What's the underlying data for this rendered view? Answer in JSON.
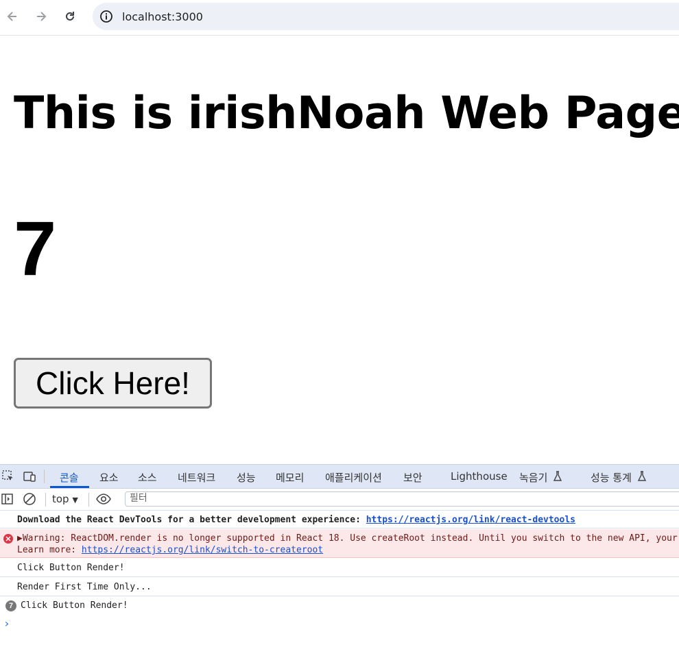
{
  "browser": {
    "url": "localhost:3000",
    "icons": [
      "back-arrow-icon",
      "forward-arrow-icon",
      "reload-icon",
      "site-info-icon"
    ]
  },
  "page": {
    "title": "This is irishNoah Web Page!",
    "counter": "7",
    "button_label": "Click Here!"
  },
  "devtools": {
    "tabs": [
      {
        "label": "콘솔",
        "active": true
      },
      {
        "label": "요소"
      },
      {
        "label": "소스"
      },
      {
        "label": "네트워크"
      },
      {
        "label": "성능"
      },
      {
        "label": "메모리"
      },
      {
        "label": "애플리케이션"
      },
      {
        "label": "보안"
      },
      {
        "label": "Lighthouse"
      },
      {
        "label": "녹음기"
      },
      {
        "label": "성능 통계"
      }
    ],
    "context": "top",
    "filter_placeholder": "필터",
    "messages": {
      "m1_text": "Download the React DevTools for a better development experience: ",
      "m1_link": "https://reactjs.org/link/react-devtools",
      "m2_line1": "▶Warning: ReactDOM.render is no longer supported in React 18. Use createRoot instead. Until you switch to the new API, your app will b",
      "m2_line2": "Learn more: ",
      "m2_link": "https://reactjs.org/link/switch-to-createroot",
      "m3": "Click Button Render!",
      "m4": "Render First Time Only...",
      "m5_count": "7",
      "m5": "Click Button Render!"
    },
    "prompt": "›",
    "colors": {
      "accent": "#0b57d0",
      "error_bg": "#fce8e8",
      "error_icon": "#dc3545",
      "link": "#1a4fcf"
    }
  }
}
